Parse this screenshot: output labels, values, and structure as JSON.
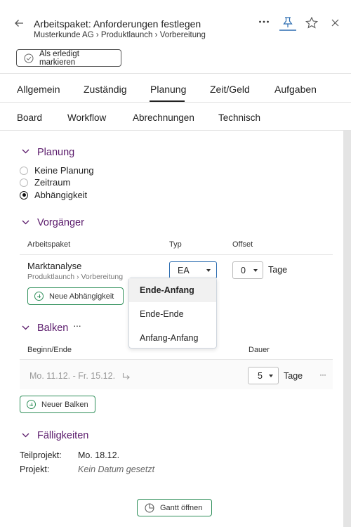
{
  "header": {
    "title_prefix": "Arbeitspaket:",
    "title": "Anforderungen festlegen",
    "breadcrumb": [
      "Musterkunde AG",
      "Produktlaunch",
      "Vorbereitung"
    ],
    "mark_done_label": "Als erledigt markieren"
  },
  "tabs": {
    "items": [
      {
        "label": "Allgemein"
      },
      {
        "label": "Zuständig"
      },
      {
        "label": "Planung"
      },
      {
        "label": "Zeit/Geld"
      },
      {
        "label": "Aufgaben"
      }
    ],
    "active": "Planung"
  },
  "subtabs": {
    "items": [
      {
        "label": "Board"
      },
      {
        "label": "Workflow"
      },
      {
        "label": "Abrechnungen"
      },
      {
        "label": "Technisch"
      }
    ]
  },
  "planung": {
    "title": "Planung",
    "options": [
      {
        "label": "Keine Planung",
        "selected": false
      },
      {
        "label": "Zeitraum",
        "selected": false
      },
      {
        "label": "Abhängigkeit",
        "selected": true
      }
    ]
  },
  "vorgaenger": {
    "title": "Vorgänger",
    "columns": {
      "workpackage": "Arbeitspaket",
      "type": "Typ",
      "offset": "Offset"
    },
    "row": {
      "name": "Marktanalyse",
      "path": [
        "Produktlaunch",
        "Vorbereitung"
      ],
      "type": "EA",
      "offset": "0",
      "offset_unit": "Tage"
    },
    "add_label": "Neue Abhängigkeit",
    "type_dropdown": {
      "options": [
        "Ende-Anfang",
        "Ende-Ende",
        "Anfang-Anfang"
      ],
      "selected": "Ende-Anfang"
    }
  },
  "balken": {
    "title": "Balken",
    "more": "···",
    "columns": {
      "range": "Beginn/Ende",
      "duration": "Dauer"
    },
    "row": {
      "range": "Mo. 11.12. - Fr. 15.12.",
      "duration": "5",
      "unit": "Tage",
      "more": "···"
    },
    "add_label": "Neuer Balken"
  },
  "faelligkeiten": {
    "title": "Fälligkeiten",
    "rows": [
      {
        "key": "Teilprojekt:",
        "value": "Mo. 18.12."
      },
      {
        "key": "Projekt:",
        "value": "Kein Datum gesetzt"
      }
    ]
  },
  "gantt_label": "Gantt öffnen",
  "colors": {
    "accent_purple": "#5a1a6b",
    "green": "#2f8f5a",
    "blue": "#2b6cb0"
  }
}
